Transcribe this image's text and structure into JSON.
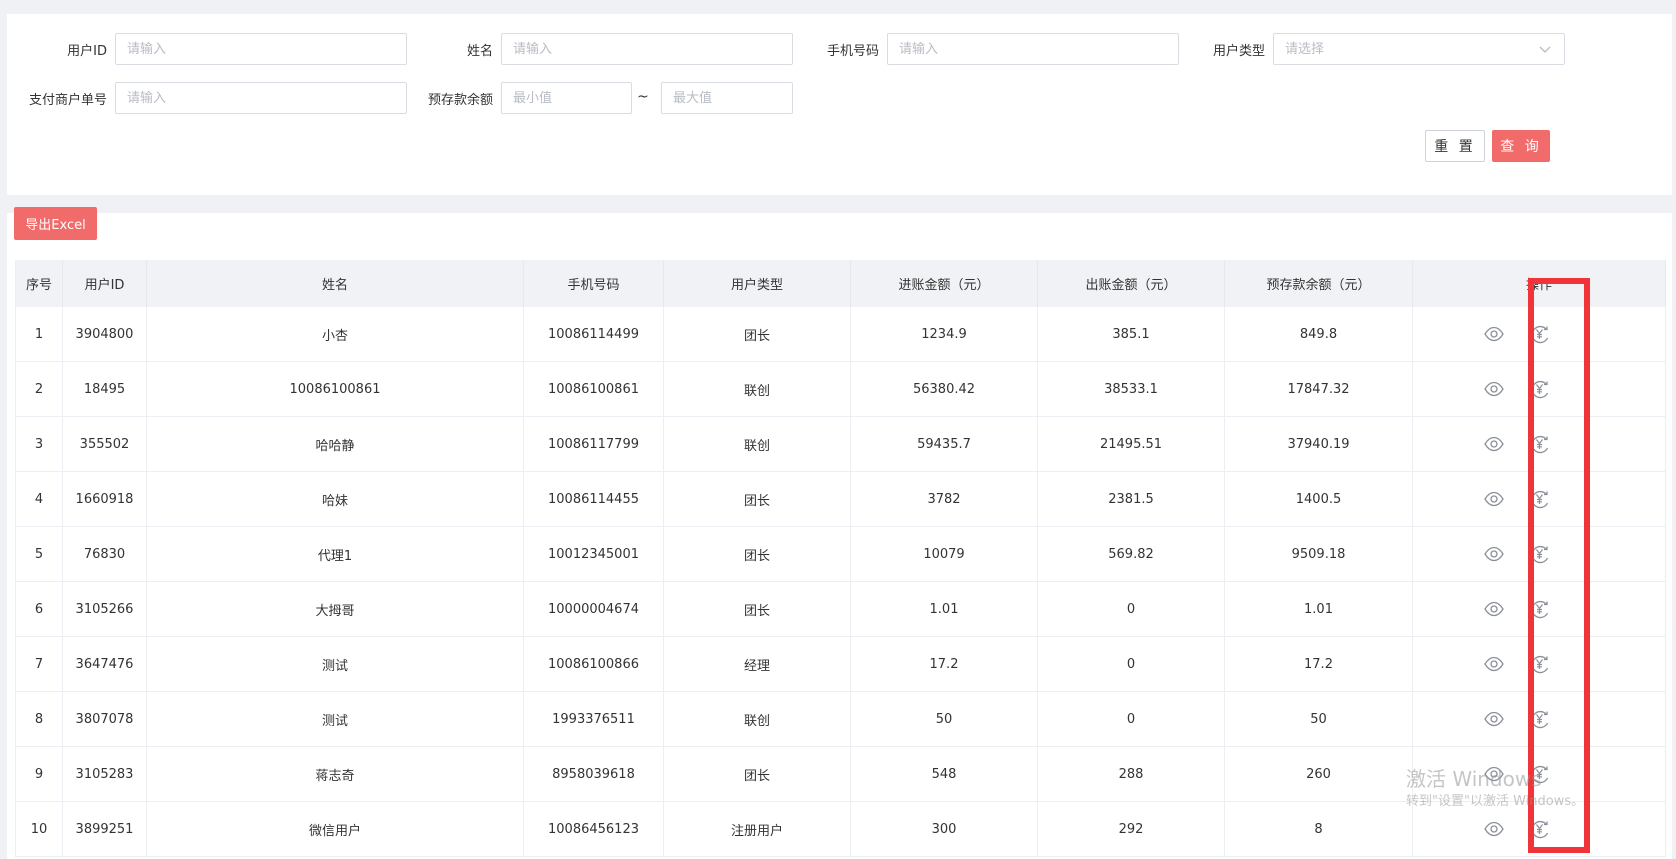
{
  "filters": {
    "user_id": {
      "label": "用户ID",
      "placeholder": "请输入"
    },
    "name": {
      "label": "姓名",
      "placeholder": "请输入"
    },
    "phone": {
      "label": "手机号码",
      "placeholder": "请输入"
    },
    "user_type": {
      "label": "用户类型",
      "placeholder": "请选择"
    },
    "merchant_order": {
      "label": "支付商户单号",
      "placeholder": "请输入"
    },
    "deposit_balance": {
      "label": "预存款余额",
      "min_placeholder": "最小值",
      "separator": "~",
      "max_placeholder": "最大值"
    }
  },
  "buttons": {
    "reset": "重 置",
    "query": "查 询",
    "export": "导出Excel"
  },
  "table": {
    "headers": [
      "序号",
      "用户ID",
      "姓名",
      "手机号码",
      "用户类型",
      "进账金额（元）",
      "出账金额（元）",
      "预存款余额（元）",
      "操作"
    ],
    "rows": [
      [
        "1",
        "3904800",
        "小杏",
        "10086114499",
        "团长",
        "1234.9",
        "385.1",
        "849.8"
      ],
      [
        "2",
        "18495",
        "10086100861",
        "10086100861",
        "联创",
        "56380.42",
        "38533.1",
        "17847.32"
      ],
      [
        "3",
        "355502",
        "哈哈静",
        "10086117799",
        "联创",
        "59435.7",
        "21495.51",
        "37940.19"
      ],
      [
        "4",
        "1660918",
        "哈妹",
        "10086114455",
        "团长",
        "3782",
        "2381.5",
        "1400.5"
      ],
      [
        "5",
        "76830",
        "代理1",
        "10012345001",
        "团长",
        "10079",
        "569.82",
        "9509.18"
      ],
      [
        "6",
        "3105266",
        "大拇哥",
        "10000004674",
        "团长",
        "1.01",
        "0",
        "1.01"
      ],
      [
        "7",
        "3647476",
        "测试",
        "10086100866",
        "经理",
        "17.2",
        "0",
        "17.2"
      ],
      [
        "8",
        "3807078",
        "测试",
        "1993376511",
        "联创",
        "50",
        "0",
        "50"
      ],
      [
        "9",
        "3105283",
        "蒋志奇",
        "8958039618",
        "团长",
        "548",
        "288",
        "260"
      ],
      [
        "10",
        "3899251",
        "微信用户",
        "10086456123",
        "注册用户",
        "300",
        "292",
        "8"
      ]
    ],
    "row_actions": [
      "eye-icon",
      "yuan-refund-icon"
    ]
  },
  "watermark": {
    "title": "激活 Windows",
    "subtitle": "转到\"设置\"以激活 Windows。"
  },
  "colors": {
    "accent": "#f26b6b",
    "highlight_box": "#f0343a",
    "page_bg": "#eff1f5",
    "header_bg": "#f1f2f5"
  }
}
